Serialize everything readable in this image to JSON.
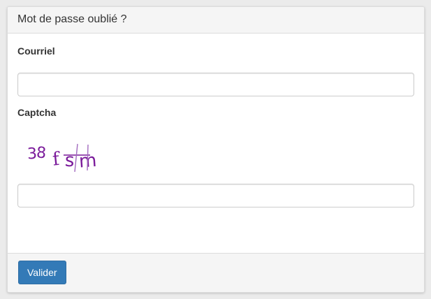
{
  "panel": {
    "title": "Mot de passe oublié ?"
  },
  "form": {
    "email_label": "Courriel",
    "email_value": "",
    "captcha_label": "Captcha",
    "captcha_text": "38fsm",
    "captcha_value": ""
  },
  "footer": {
    "submit_label": "Valider"
  },
  "colors": {
    "primary": "#337ab7",
    "captcha_ink": "#7a1a9a",
    "panel_header_bg": "#f5f5f5"
  }
}
